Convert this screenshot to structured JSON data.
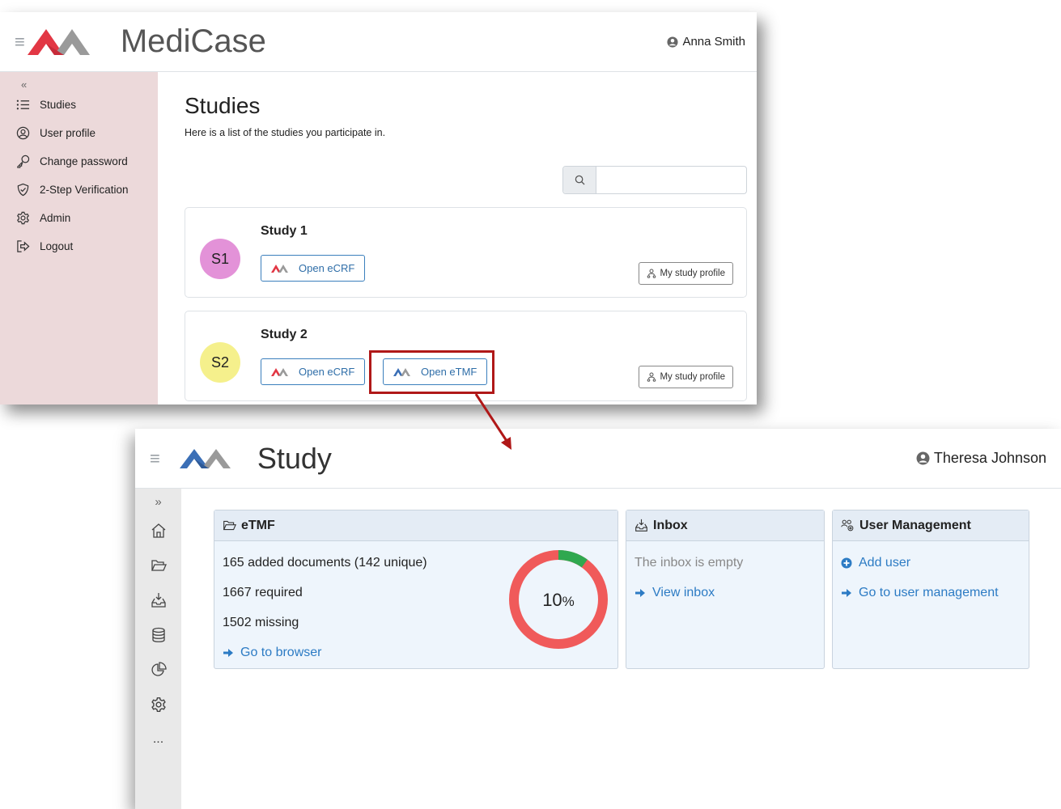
{
  "window_top": {
    "brand": "MediCase",
    "user": "Anna Smith",
    "sidebar": {
      "collapse": "«",
      "items": [
        {
          "label": "Studies",
          "icon": "list-icon"
        },
        {
          "label": "User profile",
          "icon": "user-circle-icon"
        },
        {
          "label": "Change password",
          "icon": "key-icon"
        },
        {
          "label": "2-Step Verification",
          "icon": "shield-check-icon"
        },
        {
          "label": "Admin",
          "icon": "gear-icon"
        },
        {
          "label": "Logout",
          "icon": "logout-icon"
        }
      ]
    },
    "main": {
      "title": "Studies",
      "description": "Here is a list of the studies you participate in.",
      "search_placeholder": ""
    },
    "studies": [
      {
        "avatar": "S1",
        "avatar_color": "#e392d8",
        "title": "Study 1",
        "buttons": [
          "Open eCRF"
        ],
        "profile": "My study profile"
      },
      {
        "avatar": "S2",
        "avatar_color": "#f5f08c",
        "title": "Study 2",
        "buttons": [
          "Open eCRF",
          "Open eTMF"
        ],
        "profile": "My study profile"
      }
    ]
  },
  "window_bottom": {
    "brand": "Study",
    "user": "Theresa Johnson",
    "sidebar": {
      "collapse": "»",
      "icons": [
        "home-icon",
        "folder-icon",
        "inbox-icon",
        "database-icon",
        "pie-chart-icon",
        "gear-icon",
        "more-icon"
      ],
      "more_label": "..."
    },
    "panels": {
      "etmf": {
        "title": "eTMF",
        "added": "165 added documents (142 unique)",
        "required": "1667 required",
        "missing": "1502 missing",
        "link": "Go to browser",
        "percent": 10,
        "percent_label": "10",
        "percent_sign": "%"
      },
      "inbox": {
        "title": "Inbox",
        "empty": "The inbox is empty",
        "link": "View inbox"
      },
      "users": {
        "title": "User Management",
        "add": "Add user",
        "link": "Go to user management"
      }
    }
  },
  "colors": {
    "ecrf_red": "#e23744",
    "etmf_blue": "#3b6fb6",
    "logo_gray": "#9a9a9a",
    "link_blue": "#2c7bc4",
    "highlight": "#b01818",
    "donut_red": "#f05a5a",
    "donut_green": "#2fa84f"
  }
}
